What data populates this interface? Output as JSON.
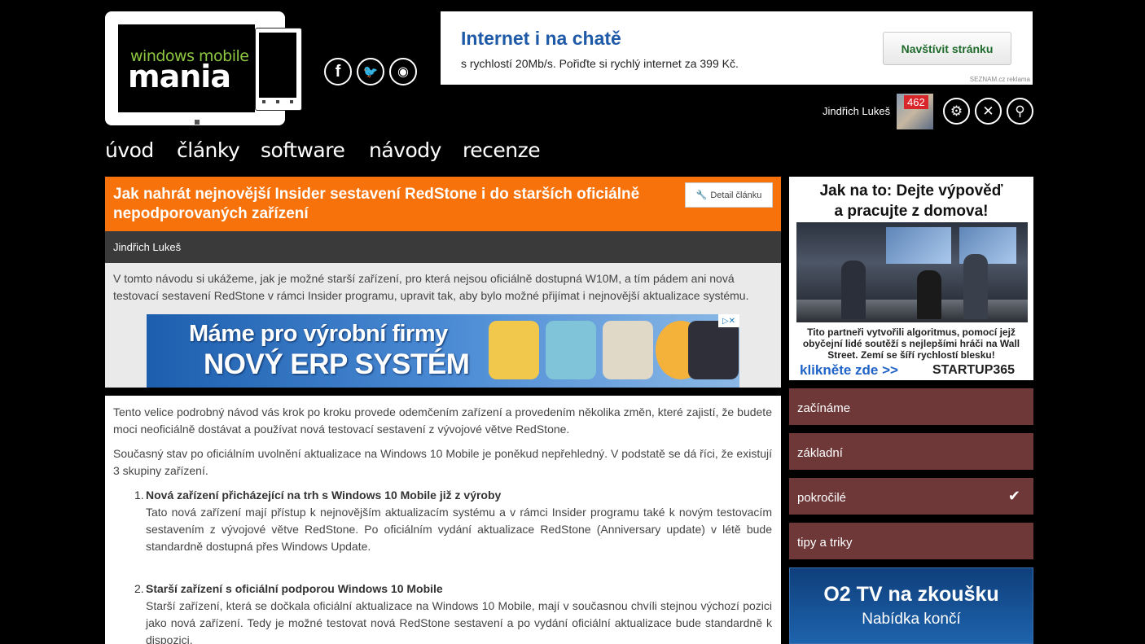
{
  "logo": {
    "line1": "windows mobile",
    "line2": "mania"
  },
  "social": [
    {
      "icon": "facebook-icon",
      "glyph": "f"
    },
    {
      "icon": "twitter-icon",
      "glyph": "🐦"
    },
    {
      "icon": "rss-icon",
      "glyph": "◉"
    }
  ],
  "top_ad": {
    "title": "Internet i na chatě",
    "text": "s rychlostí 20Mb/s. Pořiďte si rychlý internet za 399 Kč.",
    "button": "Navštívit stránku",
    "source": "SEZNAM.cz reklama"
  },
  "user": {
    "name": "Jindřich Lukeš",
    "badge": "462"
  },
  "controls": {
    "settings": "⚙",
    "close": "✕",
    "search": "⚲"
  },
  "nav": [
    "úvod",
    "články",
    "software",
    "návody",
    "recenze"
  ],
  "article": {
    "title": "Jak nahrát nejnovější Insider sestavení RedStone i do starších oficiálně nepodporovaných zařízení",
    "detail_button": "Detail článku",
    "author": "Jindřich Lukeš",
    "lead": "V tomto návodu si ukážeme, jak je možné starší zařízení, pro která nejsou oficiálně dostupná W10M, a tím pádem ani nová testovací sestavení RedStone v rámci Insider programu, upravit tak, aby bylo možné přijímat i nejnovější aktualizace systému.",
    "p1": "Tento velice podrobný návod vás krok po kroku provede odemčením zařízení a provedením několika změn, které zajistí, že budete moci neoficiálně dostávat a používat nová testovací sestavení z vývojové větve RedStone.",
    "p2": "Současný stav po oficiálním uvolnění aktualizace na Windows 10 Mobile je poněkud nepřehledný. V podstatě se dá říci, že existují 3 skupiny zařízení.",
    "list": [
      {
        "num": "1.",
        "title": "Nová zařízení přicházející na trh s Windows 10 Mobile již z výroby",
        "text": "Tato nová zařízení mají přístup k nejnovějším aktualizacím systému a v rámci Insider programu také k novým testovacím sestavením z vývojové větve RedStone. Po oficiálním vydání aktualizace RedStone (Anniversary update) v létě bude standardně dostupná přes Windows Update."
      },
      {
        "num": "2.",
        "title": "Starší zařízení s oficiální podporou Windows 10 Mobile",
        "text": "Starší zařízení, která se dočkala oficiální aktualizace na Windows 10 Mobile, mají v současnou chvíli stejnou výchozí pozici jako nová zařízení. Tedy je možné testovat nová RedStone sestavení a po vydání oficiální aktualizace bude standardně k dispozici."
      }
    ]
  },
  "erp_ad": {
    "line1": "Máme pro výrobní firmy",
    "line2": "NOVÝ ERP SYSTÉM",
    "adchoice": "▷✕"
  },
  "right_ad": {
    "title_l1": "Jak na to: Dejte výpověď",
    "title_l2": "a pracujte z domova!",
    "text": "Tito partneři vytvořili algoritmus, pomocí jejž obyčejní lidé soutěží s nejlepšími hráči na Wall Street.  Zemí se šíří rychlostí blesku!",
    "link": "klikněte zde >>",
    "brand": "STARTUP365"
  },
  "categories": [
    {
      "label": "začínáme",
      "checked": false
    },
    {
      "label": "základní",
      "checked": false
    },
    {
      "label": "pokročilé",
      "checked": true,
      "check_glyph": "✔"
    },
    {
      "label": "tipy a triky",
      "checked": false
    }
  ],
  "o2_ad": {
    "title": "O2 TV na zkoušku",
    "subtitle": "Nabídka končí"
  }
}
